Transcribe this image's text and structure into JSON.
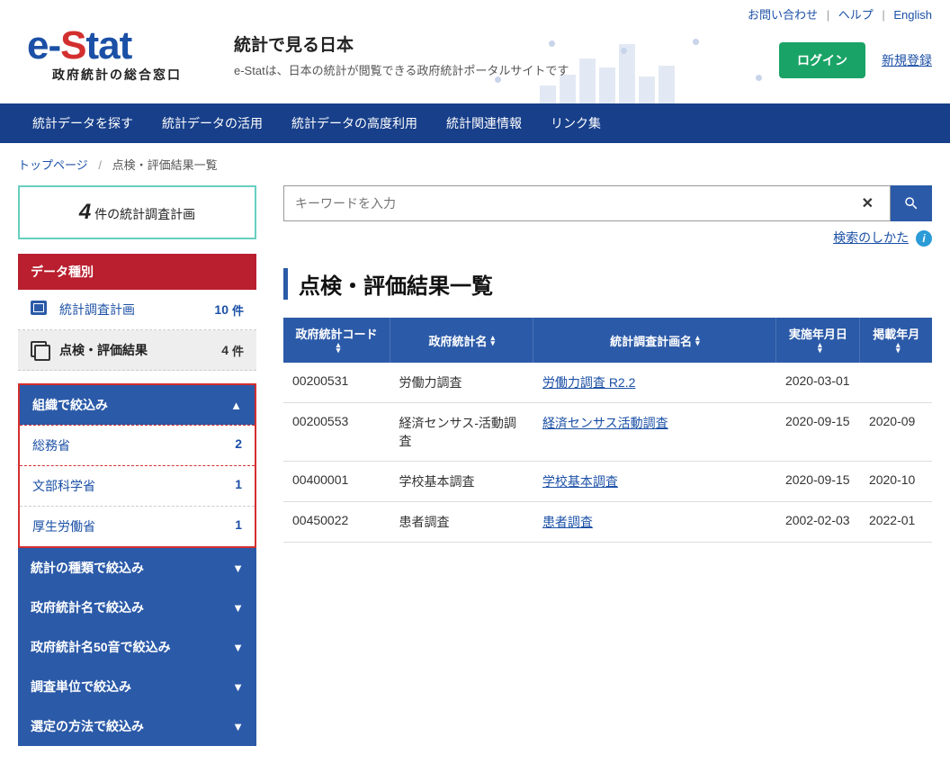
{
  "top_links": {
    "contact": "お問い合わせ",
    "help": "ヘルプ",
    "english": "English"
  },
  "logo": {
    "sub": "政府統計の総合窓口"
  },
  "tagline": {
    "title": "統計で見る日本",
    "desc": "e-Statは、日本の統計が閲覧できる政府統計ポータルサイトです"
  },
  "header": {
    "login": "ログイン",
    "register": "新規登録"
  },
  "nav": [
    "統計データを探す",
    "統計データの活用",
    "統計データの高度利用",
    "統計関連情報",
    "リンク集"
  ],
  "breadcrumb": {
    "home": "トップページ",
    "current": "点検・評価結果一覧"
  },
  "count_box": {
    "n": "4",
    "txt": "件の統計調査計画"
  },
  "data_type": {
    "header": "データ種別",
    "items": [
      {
        "label": "統計調査計画",
        "count": "10",
        "unit": "件"
      },
      {
        "label": "点検・評価結果",
        "count": "4",
        "unit": "件"
      }
    ]
  },
  "filter_open": {
    "header": "組織で絞込み",
    "items": [
      {
        "label": "総務省",
        "count": "2"
      },
      {
        "label": "文部科学省",
        "count": "1"
      },
      {
        "label": "厚生労働省",
        "count": "1"
      }
    ]
  },
  "filter_panels": [
    "統計の種類で絞込み",
    "政府統計名で絞込み",
    "政府統計名50音で絞込み",
    "調査単位で絞込み",
    "選定の方法で絞込み"
  ],
  "search": {
    "placeholder": "キーワードを入力",
    "help": "検索のしかた"
  },
  "page_title": "点検・評価結果一覧",
  "table": {
    "headers": [
      "政府統計コード",
      "政府統計名",
      "統計調査計画名",
      "実施年月日",
      "掲載年月"
    ],
    "rows": [
      {
        "code": "00200531",
        "name": "労働力調査",
        "plan": "労働力調査 R2.2",
        "date": "2020-03-01",
        "pub": ""
      },
      {
        "code": "00200553",
        "name": "経済センサス-活動調査",
        "plan": "経済センサス活動調査",
        "date": "2020-09-15",
        "pub": "2020-09"
      },
      {
        "code": "00400001",
        "name": "学校基本調査",
        "plan": "学校基本調査",
        "date": "2020-09-15",
        "pub": "2020-10"
      },
      {
        "code": "00450022",
        "name": "患者調査",
        "plan": "患者調査",
        "date": "2002-02-03",
        "pub": "2022-01"
      }
    ]
  }
}
